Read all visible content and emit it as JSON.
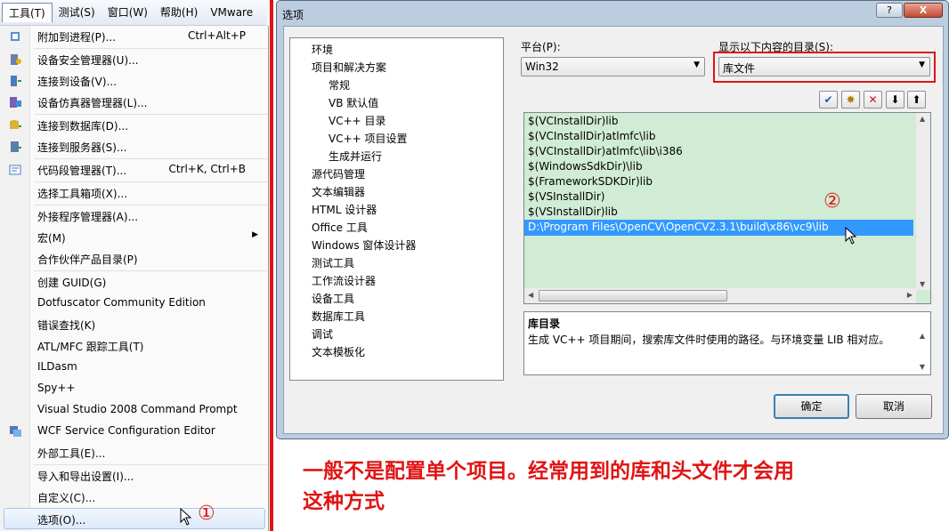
{
  "menubar": {
    "items": [
      "工具(T)",
      "测试(S)",
      "窗口(W)",
      "帮助(H)",
      "VMware"
    ]
  },
  "tools_menu": {
    "items": [
      {
        "label": "附加到进程(P)...",
        "shortcut": "Ctrl+Alt+P",
        "icon": "attach-process-icon"
      },
      {
        "label": "设备安全管理器(U)...",
        "icon": "device-security-icon"
      },
      {
        "label": "连接到设备(V)...",
        "icon": "connect-device-icon"
      },
      {
        "label": "设备仿真器管理器(L)...",
        "icon": "device-emulator-icon"
      },
      {
        "label": "连接到数据库(D)...",
        "icon": "connect-database-icon"
      },
      {
        "label": "连接到服务器(S)...",
        "icon": "connect-server-icon"
      },
      {
        "label": "代码段管理器(T)...",
        "shortcut": "Ctrl+K, Ctrl+B",
        "icon": "code-snippet-icon"
      },
      {
        "label": "选择工具箱项(X)..."
      },
      {
        "label": "外接程序管理器(A)..."
      },
      {
        "label": "宏(M)"
      },
      {
        "label": "合作伙伴产品目录(P)"
      },
      {
        "label": "创建 GUID(G)"
      },
      {
        "label": "Dotfuscator Community Edition"
      },
      {
        "label": "错误查找(K)"
      },
      {
        "label": "ATL/MFC 跟踪工具(T)"
      },
      {
        "label": "ILDasm"
      },
      {
        "label": "Spy++"
      },
      {
        "label": "Visual Studio 2008 Command Prompt"
      },
      {
        "label": "WCF Service Configuration Editor",
        "icon": "wcf-editor-icon"
      },
      {
        "label": "外部工具(E)..."
      },
      {
        "label": "导入和导出设置(I)..."
      },
      {
        "label": "自定义(C)..."
      },
      {
        "label": "选项(O)..."
      }
    ]
  },
  "dialog": {
    "title": "选项",
    "help_label": "?",
    "close_label": "X",
    "tree": [
      "环境",
      "项目和解决方案",
      "常规",
      "VB 默认值",
      "VC++ 目录",
      "VC++ 项目设置",
      "生成并运行",
      "源代码管理",
      "文本编辑器",
      "HTML 设计器",
      "Office 工具",
      "Windows 窗体设计器",
      "测试工具",
      "工作流设计器",
      "设备工具",
      "数据库工具",
      "调试",
      "文本模板化"
    ],
    "platform_label": "平台(P):",
    "platform_value": "Win32",
    "dirs_label": "显示以下内容的目录(S):",
    "dirs_value": "库文件",
    "toolbar_glyphs": [
      "✔",
      "✸",
      "✕",
      "⬇",
      "⬆"
    ],
    "paths": [
      "$(VCInstallDir)lib",
      "$(VCInstallDir)atlmfc\\lib",
      "$(VCInstallDir)atlmfc\\lib\\i386",
      "$(WindowsSdkDir)\\lib",
      "$(FrameworkSDKDir)lib",
      "$(VSInstallDir)",
      "$(VSInstallDir)lib",
      "D:\\Program Files\\OpenCV\\OpenCV2.3.1\\build\\x86\\vc9\\lib"
    ],
    "desc_title": "库目录",
    "desc_text": "生成 VC++ 项目期间，搜索库文件时使用的路径。与环境变量 LIB 相对应。",
    "ok_label": "确定",
    "cancel_label": "取消"
  },
  "annotations": {
    "marker1": "①",
    "marker2": "②",
    "caption_line1": "一般不是配置单个项目。经常用到的库和头文件才会用",
    "caption_line2": "这种方式"
  },
  "colors": {
    "accent_red": "#e01414",
    "selection_blue": "#3399ff",
    "list_bg": "#d0ecd5"
  }
}
